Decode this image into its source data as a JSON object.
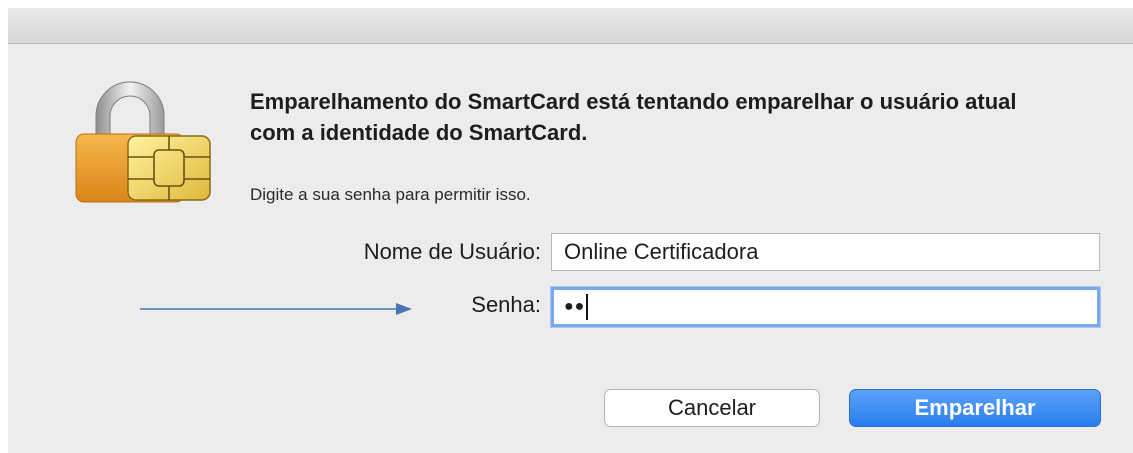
{
  "dialog": {
    "heading": "Emparelhamento do SmartCard está tentando emparelhar o usuário atual com a identidade do SmartCard.",
    "subtext": "Digite a sua senha para permitir isso.",
    "icon": "smartcard-lock-icon"
  },
  "form": {
    "username_label": "Nome de Usuário:",
    "username_value": "Online Certificadora",
    "password_label": "Senha:",
    "password_mask": "●●"
  },
  "buttons": {
    "cancel_label": "Cancelar",
    "confirm_label": "Emparelhar"
  },
  "annotation": {
    "arrow_icon": "arrow-right-icon",
    "arrow_color": "#4a74b4"
  },
  "colors": {
    "accent": "#2a7cf0",
    "focus_ring": "#79a9e8",
    "dialog_bg": "#ececec"
  }
}
